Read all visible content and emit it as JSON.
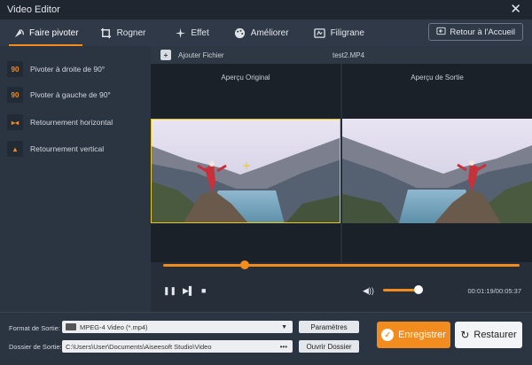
{
  "window": {
    "title": "Video Editor",
    "close_glyph": "✕"
  },
  "toolbar": {
    "tabs": [
      {
        "label": "Faire pivoter",
        "icon": "rotate-icon",
        "active": true
      },
      {
        "label": "Rogner",
        "icon": "crop-icon"
      },
      {
        "label": "Effet",
        "icon": "sparkle-icon"
      },
      {
        "label": "Améliorer",
        "icon": "palette-icon"
      },
      {
        "label": "Filigrane",
        "icon": "watermark-icon"
      }
    ],
    "home_label": "Retour à l'Accueil"
  },
  "sidebar": {
    "items": [
      {
        "label": "Pivoter à droite de 90°",
        "icon_text": "90"
      },
      {
        "label": "Pivoter à gauche de 90°",
        "icon_text": "90"
      },
      {
        "label": "Retournement horizontal",
        "icon_text": "▸◂"
      },
      {
        "label": "Retournement vertical",
        "icon_text": "▴"
      }
    ]
  },
  "filebar": {
    "add_label": "Ajouter Fichier",
    "filename": "test2.MP4"
  },
  "preview": {
    "original_label": "Aperçu Original",
    "output_label": "Aperçu de Sortie"
  },
  "player": {
    "progress": 0.23,
    "volume": 0.88,
    "time": "00:01:19/00:05:37"
  },
  "output": {
    "format_label": "Format de Sortie:",
    "format_value": "MPEG-4 Video (*.mp4)",
    "params_label": "Paramètres",
    "folder_label": "Dossier de Sortie:",
    "folder_value": "C:\\Users\\User\\Documents\\Aiseesoft Studio\\Video",
    "open_folder_label": "Ouvrir Dossier",
    "save_label": "Enregistrer",
    "restore_label": "Restaurer"
  },
  "colors": {
    "accent": "#f28c1e",
    "bg": "#2b3441",
    "selection": "#e8c820"
  }
}
